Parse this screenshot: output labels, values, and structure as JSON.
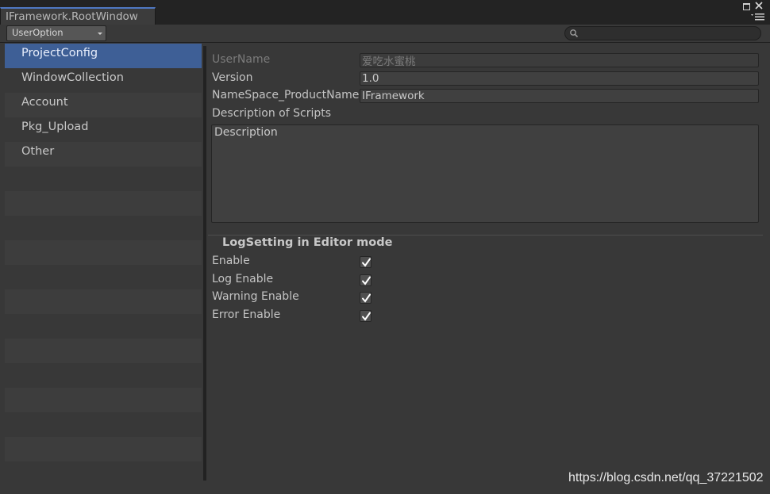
{
  "window": {
    "title": "IFramework.RootWindow"
  },
  "toolbar": {
    "dropdown_value": "UserOption",
    "search_placeholder": ""
  },
  "left_list": {
    "selected_index": 0,
    "items": [
      {
        "label": "ProjectConfig"
      },
      {
        "label": "WindowCollection"
      },
      {
        "label": "Account"
      },
      {
        "label": "Pkg_Upload"
      },
      {
        "label": "Other"
      }
    ]
  },
  "project_config": {
    "user_name": {
      "label": "UserName",
      "value": "爱吃水蜜桃"
    },
    "version": {
      "label": "Version",
      "value": "1.0"
    },
    "namespace": {
      "label": "NameSpace_ProductName",
      "value": "IFramework"
    },
    "description": {
      "label": "Description of Scripts",
      "value": "Description"
    }
  },
  "log_setting": {
    "header": "LogSetting in Editor mode",
    "options": [
      {
        "label": "Enable",
        "checked": true
      },
      {
        "label": "Log Enable",
        "checked": true
      },
      {
        "label": "Warning Enable",
        "checked": true
      },
      {
        "label": "Error Enable",
        "checked": true
      }
    ]
  },
  "watermark": "https://blog.csdn.net/qq_37221502",
  "icons": {
    "maximize": "maximize-icon",
    "close": "close-icon",
    "menu": "context-menu-icon",
    "search": "search-icon",
    "check": "check-icon"
  },
  "colors": {
    "selection": "#3e5f96",
    "tab_accent": "#4f78c2",
    "background": "#383838"
  }
}
